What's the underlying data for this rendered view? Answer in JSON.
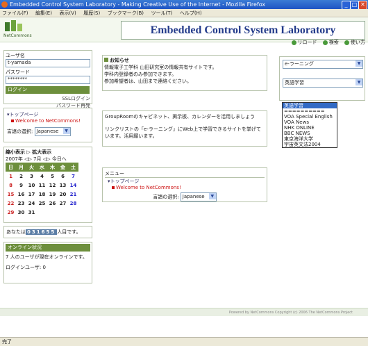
{
  "window": {
    "title": "Embedded Control System Laboratory - Making Creative Use of the Internet - Mozilla Firefox",
    "min": "_",
    "max": "□",
    "close": "✕"
  },
  "menubar": [
    "ファイル(F)",
    "編集(E)",
    "表示(V)",
    "履歴(S)",
    "ブックマーク(B)",
    "ツール(T)",
    "ヘルプ(H)"
  ],
  "header": {
    "logo_text": "NetCommons",
    "banner": "Embedded Control System Laboratory",
    "links": [
      "リロード",
      "検索",
      "使い方"
    ]
  },
  "login": {
    "user_label": "ユーザ名",
    "user_value": "t-yamada",
    "pass_label": "パスワード",
    "pass_value": "********",
    "login_btn": "ログイン",
    "ssl_login": "SSLログイン",
    "pass_reissue": "パスワード再発"
  },
  "topmenu": {
    "item": "トップページ",
    "sub": "Welcome to NetCommons!",
    "lang_label": "言語の選択:",
    "lang_value": "Japanese"
  },
  "calendar": {
    "title": "縮小表示 ▷ 拡大表示",
    "month": "2007年",
    "nav": "◁▷ 7月 ◁▷ 今日へ",
    "days": [
      "日",
      "月",
      "火",
      "水",
      "木",
      "金",
      "土"
    ],
    "weeks": [
      [
        "1",
        "2",
        "3",
        "4",
        "5",
        "6",
        "7"
      ],
      [
        "8",
        "9",
        "10",
        "11",
        "12",
        "13",
        "14"
      ],
      [
        "15",
        "16",
        "17",
        "18",
        "19",
        "20",
        "21"
      ],
      [
        "22",
        "23",
        "24",
        "25",
        "26",
        "27",
        "28"
      ],
      [
        "29",
        "30",
        "31",
        "",
        "",
        "",
        ""
      ]
    ]
  },
  "counter": {
    "prefix": "あなたは",
    "digits": "031655",
    "suffix": "人目です。"
  },
  "online": {
    "title": "オンライン状況",
    "text": "7 人のユーザが現在オンラインです。",
    "login_users": "ログインユーザ: 0"
  },
  "notice": {
    "title": "お知らせ",
    "lines": [
      "情報電子工学科 山田研究室の情報共有サイトです。",
      "学科内登録者のみ参加できます。",
      "参加希望者は、山田まで連絡ください。"
    ]
  },
  "groupinfo": {
    "line1": "GroupRoomのキャビネット、掲示板、カレンダーを活用しましょう",
    "line2": "リンクリストの「e-ラーニング」にWeb上で学習できるサイトを挙げています。活用願います。"
  },
  "menu2": {
    "title": "メニュー",
    "item": "トップページ",
    "sub": "Welcome to NetCommons!",
    "lang_label": "言語の選択:",
    "lang_value": "Japanese"
  },
  "right": {
    "select1": "e-ラーニング",
    "select2": "英語学習",
    "options": [
      "英語学習",
      "==========",
      "VOA Special English",
      "VOA News",
      "NHK ONLINE",
      "BBC NEWS",
      "東京海洋大学",
      "宇宙英文法2004"
    ]
  },
  "footer": "Powered by NetCommons Copyright (c) 2006 The NetCommons Project",
  "status": "完了"
}
